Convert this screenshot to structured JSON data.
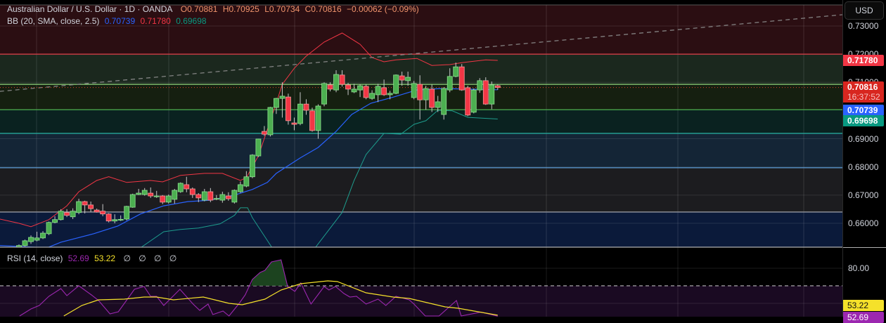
{
  "header": {
    "symbol": "Australian Dollar / U.S. Dollar · 1D · OANDA",
    "open": "O0.70881",
    "high": "H0.70925",
    "low": "L0.70734",
    "close": "C0.70816",
    "change": "−0.00062 (−0.09%)"
  },
  "bb_legend": {
    "label": "BB (20, SMA, close, 2.5)",
    "basis": "0.70739",
    "upper": "0.71780",
    "lower": "0.69698"
  },
  "rsi_legend": {
    "label": "RSI (14, close)",
    "rsi": "52.69",
    "ma": "53.22",
    "extras": [
      "∅",
      "∅",
      "∅",
      "∅"
    ]
  },
  "price_axis": {
    "currency": "USD",
    "ticks": [
      "0.73000",
      "0.72000",
      "0.71000",
      "0.69000",
      "0.68000",
      "0.67000",
      "0.66000"
    ],
    "tick_values": [
      0.73,
      0.72,
      0.71,
      0.69,
      0.68,
      0.67,
      0.66
    ],
    "last_price": "0.70816",
    "countdown": "16:37:52",
    "bb_upper": "0.71780",
    "bb_basis": "0.70739",
    "bb_lower": "0.69698"
  },
  "rsi_axis": {
    "ticks": [
      "80.00"
    ],
    "tick_values": [
      80
    ],
    "ma_label": "53.22",
    "rsi_label": "52.69"
  },
  "colors": {
    "up": "#4caf50",
    "down": "#f23645",
    "bb_basis": "#2962ff",
    "bb_upper": "#f23645",
    "bb_lower": "#089981",
    "rsi": "#9c27b0",
    "rsi_ma": "#f5e12a",
    "ohlc_text": "#f0946c"
  },
  "chart_data": {
    "type": "candlestick",
    "title": "Australian Dollar / U.S. Dollar · 1D · OANDA",
    "ylim": [
      0.6537,
      0.74
    ],
    "candles": [
      [
        0.6513,
        0.6525,
        0.6508,
        0.6521
      ],
      [
        0.6521,
        0.6542,
        0.6518,
        0.6538
      ],
      [
        0.6535,
        0.6557,
        0.6527,
        0.655
      ],
      [
        0.654,
        0.657,
        0.6536,
        0.6548
      ],
      [
        0.6548,
        0.6572,
        0.6544,
        0.6565
      ],
      [
        0.6563,
        0.6606,
        0.6558,
        0.6603
      ],
      [
        0.6603,
        0.6625,
        0.66,
        0.6613
      ],
      [
        0.6613,
        0.665,
        0.661,
        0.6643
      ],
      [
        0.6638,
        0.665,
        0.6622,
        0.6628
      ],
      [
        0.6623,
        0.6653,
        0.6615,
        0.6643
      ],
      [
        0.6638,
        0.6687,
        0.6632,
        0.6677
      ],
      [
        0.6677,
        0.668,
        0.6635,
        0.6665
      ],
      [
        0.6665,
        0.6677,
        0.664,
        0.6652
      ],
      [
        0.6647,
        0.6652,
        0.6638,
        0.664
      ],
      [
        0.6643,
        0.6668,
        0.6625,
        0.6633
      ],
      [
        0.6633,
        0.6636,
        0.6603,
        0.6608
      ],
      [
        0.6608,
        0.6632,
        0.66,
        0.6613
      ],
      [
        0.6613,
        0.6628,
        0.6608,
        0.6614
      ],
      [
        0.6615,
        0.6662,
        0.661,
        0.666
      ],
      [
        0.6657,
        0.6705,
        0.6655,
        0.6702
      ],
      [
        0.6702,
        0.6722,
        0.67,
        0.6707
      ],
      [
        0.6702,
        0.6725,
        0.6698,
        0.6717
      ],
      [
        0.6707,
        0.6727,
        0.669,
        0.6697
      ],
      [
        0.6697,
        0.6715,
        0.669,
        0.6697
      ],
      [
        0.6697,
        0.67,
        0.6668,
        0.6675
      ],
      [
        0.6675,
        0.6702,
        0.667,
        0.6697
      ],
      [
        0.6685,
        0.6722,
        0.667,
        0.6717
      ],
      [
        0.6712,
        0.6745,
        0.6708,
        0.6742
      ],
      [
        0.6737,
        0.6765,
        0.671,
        0.6722
      ],
      [
        0.6722,
        0.6727,
        0.669,
        0.6702
      ],
      [
        0.6702,
        0.6707,
        0.6675,
        0.669
      ],
      [
        0.6682,
        0.6722,
        0.6678,
        0.6712
      ],
      [
        0.6712,
        0.6725,
        0.6675,
        0.6682
      ],
      [
        0.6687,
        0.67,
        0.6682,
        0.6688
      ],
      [
        0.6682,
        0.6712,
        0.6673,
        0.6702
      ],
      [
        0.6697,
        0.671,
        0.668,
        0.6687
      ],
      [
        0.6675,
        0.672,
        0.667,
        0.6717
      ],
      [
        0.6712,
        0.6748,
        0.6708,
        0.6737
      ],
      [
        0.6732,
        0.6785,
        0.6728,
        0.6765
      ],
      [
        0.6765,
        0.6845,
        0.676,
        0.6842
      ],
      [
        0.6839,
        0.69,
        0.6835,
        0.6899
      ],
      [
        0.6926,
        0.6945,
        0.691,
        0.6916
      ],
      [
        0.6914,
        0.7013,
        0.6908,
        0.7011
      ],
      [
        0.7011,
        0.7045,
        0.6988,
        0.7043
      ],
      [
        0.7043,
        0.71,
        0.6975,
        0.7051
      ],
      [
        0.7048,
        0.706,
        0.695,
        0.6964
      ],
      [
        0.6956,
        0.6975,
        0.693,
        0.6951
      ],
      [
        0.6954,
        0.7065,
        0.6948,
        0.7023
      ],
      [
        0.7023,
        0.704,
        0.6985,
        0.7001
      ],
      [
        0.6999,
        0.701,
        0.6925,
        0.6929
      ],
      [
        0.6929,
        0.7022,
        0.69,
        0.7016
      ],
      [
        0.7023,
        0.71,
        0.7015,
        0.7096
      ],
      [
        0.7091,
        0.71,
        0.7068,
        0.7076
      ],
      [
        0.7073,
        0.7143,
        0.7065,
        0.7128
      ],
      [
        0.7126,
        0.7143,
        0.7085,
        0.7093
      ],
      [
        0.7091,
        0.7098,
        0.7055,
        0.7076
      ],
      [
        0.7066,
        0.7095,
        0.7062,
        0.7076
      ],
      [
        0.7073,
        0.7093,
        0.7048,
        0.7088
      ],
      [
        0.7086,
        0.7092,
        0.704,
        0.7046
      ],
      [
        0.7043,
        0.7072,
        0.7038,
        0.7061
      ],
      [
        0.7056,
        0.7095,
        0.703,
        0.7086
      ],
      [
        0.7081,
        0.711,
        0.7052,
        0.7056
      ],
      [
        0.7056,
        0.707,
        0.704,
        0.7061
      ],
      [
        0.7061,
        0.7128,
        0.7058,
        0.7126
      ],
      [
        0.7123,
        0.7138,
        0.7088,
        0.7108
      ],
      [
        0.7106,
        0.7138,
        0.7088,
        0.7118
      ],
      [
        0.7046,
        0.7105,
        0.704,
        0.7096
      ],
      [
        0.7093,
        0.7125,
        0.6968,
        0.7038
      ],
      [
        0.7038,
        0.7088,
        0.7003,
        0.7078
      ],
      [
        0.7076,
        0.7092,
        0.6995,
        0.7011
      ],
      [
        0.7011,
        0.7052,
        0.6995,
        0.7031
      ],
      [
        0.6986,
        0.7083,
        0.6968,
        0.7078
      ],
      [
        0.7073,
        0.715,
        0.7065,
        0.7121
      ],
      [
        0.7121,
        0.717,
        0.7118,
        0.7155
      ],
      [
        0.7155,
        0.7165,
        0.707,
        0.7073
      ],
      [
        0.7081,
        0.7088,
        0.698,
        0.6984
      ],
      [
        0.6994,
        0.7078,
        0.699,
        0.7073
      ],
      [
        0.7073,
        0.7115,
        0.7063,
        0.7106
      ],
      [
        0.7106,
        0.7118,
        0.702,
        0.7023
      ],
      [
        0.7023,
        0.7103,
        0.7005,
        0.7091
      ],
      [
        0.70881,
        0.70925,
        0.70734,
        0.70816
      ]
    ],
    "bb_upper": [
      [
        -3.2,
        0.6615
      ],
      [
        0,
        0.66
      ],
      [
        2,
        0.6588
      ],
      [
        5,
        0.6613
      ],
      [
        8,
        0.6662
      ],
      [
        10,
        0.6712
      ],
      [
        13,
        0.6752
      ],
      [
        15,
        0.6765
      ],
      [
        18,
        0.6745
      ],
      [
        22,
        0.6752
      ],
      [
        24,
        0.6747
      ],
      [
        27,
        0.677
      ],
      [
        31,
        0.6777
      ],
      [
        34,
        0.6777
      ],
      [
        37,
        0.6752
      ],
      [
        38,
        0.6762
      ],
      [
        40,
        0.6839
      ],
      [
        41,
        0.6901
      ],
      [
        43,
        0.7026
      ],
      [
        44,
        0.7093
      ],
      [
        46,
        0.715
      ],
      [
        48,
        0.7193
      ],
      [
        51,
        0.7243
      ],
      [
        54,
        0.7275
      ],
      [
        57,
        0.7235
      ],
      [
        59,
        0.7188
      ],
      [
        61,
        0.7173
      ],
      [
        63,
        0.718
      ],
      [
        66.5,
        0.7185
      ],
      [
        69,
        0.716
      ],
      [
        72,
        0.7163
      ],
      [
        74,
        0.717
      ],
      [
        78,
        0.718
      ],
      [
        80,
        0.7178
      ]
    ],
    "bb_basis": [
      [
        -3.2,
        0.6521
      ],
      [
        4.7,
        0.6513
      ],
      [
        7,
        0.6533
      ],
      [
        12.5,
        0.6563
      ],
      [
        16.5,
        0.659
      ],
      [
        20.3,
        0.6633
      ],
      [
        24.2,
        0.6662
      ],
      [
        28.2,
        0.6677
      ],
      [
        32,
        0.6682
      ],
      [
        36,
        0.67
      ],
      [
        39,
        0.672
      ],
      [
        41.5,
        0.6745
      ],
      [
        43,
        0.6777
      ],
      [
        47,
        0.6832
      ],
      [
        50,
        0.6869
      ],
      [
        53,
        0.6926
      ],
      [
        55.6,
        0.6986
      ],
      [
        58.8,
        0.7026
      ],
      [
        62.6,
        0.7048
      ],
      [
        66.5,
        0.7073
      ],
      [
        70.5,
        0.7078
      ],
      [
        80,
        0.70739
      ]
    ],
    "bb_lower": [
      [
        19,
        0.6496
      ],
      [
        20.3,
        0.6513
      ],
      [
        24.2,
        0.657
      ],
      [
        27,
        0.6578
      ],
      [
        30,
        0.6583
      ],
      [
        33.6,
        0.6598
      ],
      [
        36,
        0.6628
      ],
      [
        37,
        0.6655
      ],
      [
        38.2,
        0.6655
      ],
      [
        39,
        0.662
      ],
      [
        42.3,
        0.6513
      ],
      [
        46,
        0.6446
      ],
      [
        49.5,
        0.6513
      ],
      [
        54,
        0.6638
      ],
      [
        56,
        0.6752
      ],
      [
        58,
        0.6844
      ],
      [
        61,
        0.6919
      ],
      [
        63.8,
        0.6916
      ],
      [
        66,
        0.6951
      ],
      [
        68,
        0.6964
      ],
      [
        70,
        0.7001
      ],
      [
        72.4,
        0.6999
      ],
      [
        75,
        0.6976
      ],
      [
        80,
        0.69698
      ]
    ],
    "levels": [
      {
        "price": 0.72,
        "color": "#e0404a"
      },
      {
        "price": 0.7093,
        "color": "#8fd47a"
      },
      {
        "price": 0.7003,
        "color": "#4caf50"
      },
      {
        "price": 0.6919,
        "color": "#26a69a"
      },
      {
        "price": 0.6797,
        "color": "#5b9bd5"
      },
      {
        "price": 0.664,
        "color": "#9598a1"
      }
    ],
    "zones": [
      {
        "from": 0.74,
        "to": 0.72,
        "color": "#2b0e12"
      },
      {
        "from": 0.72,
        "to": 0.7093,
        "color": "#1b281e"
      },
      {
        "from": 0.7093,
        "to": 0.7003,
        "color": "#151f10"
      },
      {
        "from": 0.7003,
        "to": 0.6919,
        "color": "#0a2220"
      },
      {
        "from": 0.6919,
        "to": 0.6797,
        "color": "#142536"
      },
      {
        "from": 0.6797,
        "to": 0.664,
        "color": "#1c1c1f"
      },
      {
        "from": 0.664,
        "to": 0.65,
        "color": "#0b1a3a"
      }
    ],
    "trendline": [
      [
        -3.2,
        0.7068
      ],
      [
        137.6,
        0.734
      ]
    ],
    "rsi": {
      "overbought": 70,
      "ylim": [
        52,
        90
      ],
      "values": [
        [
          0.1,
          52.8
        ],
        [
          2,
          56.8
        ],
        [
          3.4,
          58.8
        ],
        [
          5,
          64
        ],
        [
          7,
          68.4
        ],
        [
          8,
          64.4
        ],
        [
          10,
          70
        ],
        [
          12.1,
          64.8
        ],
        [
          13.3,
          61.6
        ],
        [
          15.2,
          54
        ],
        [
          16.6,
          55.2
        ],
        [
          19.3,
          68
        ],
        [
          20.9,
          69.6
        ],
        [
          22,
          64
        ],
        [
          23,
          64
        ],
        [
          24.2,
          58.8
        ],
        [
          26.9,
          68
        ],
        [
          29.1,
          59.6
        ],
        [
          30.2,
          56
        ],
        [
          31.6,
          59.6
        ],
        [
          32.4,
          53.6
        ],
        [
          34.1,
          55.6
        ],
        [
          35.1,
          52.8
        ],
        [
          36.8,
          60
        ],
        [
          37.8,
          64.8
        ],
        [
          39,
          73.6
        ],
        [
          40.3,
          77.6
        ],
        [
          41.1,
          78.8
        ],
        [
          42.2,
          83.6
        ],
        [
          43.8,
          84.8
        ],
        [
          44.9,
          69.6
        ],
        [
          46.1,
          66.8
        ],
        [
          47.1,
          71.6
        ],
        [
          48.8,
          59.6
        ],
        [
          51,
          69.6
        ],
        [
          51.8,
          67.6
        ],
        [
          52.9,
          69.6
        ],
        [
          54.3,
          65.6
        ],
        [
          55.3,
          63.6
        ],
        [
          56.4,
          64
        ],
        [
          58,
          59.6
        ],
        [
          60,
          62.4
        ],
        [
          61.3,
          58.8
        ],
        [
          63,
          64
        ],
        [
          65.2,
          62
        ],
        [
          66,
          59.6
        ],
        [
          67.9,
          52.8
        ],
        [
          70.2,
          52.8
        ],
        [
          73.1,
          61.6
        ],
        [
          73.9,
          52.8
        ],
        [
          77.2,
          55
        ],
        [
          80,
          52.69
        ]
      ],
      "ma": [
        [
          7.5,
          52.8
        ],
        [
          10.5,
          58.8
        ],
        [
          13.3,
          62
        ],
        [
          17.6,
          62.4
        ],
        [
          20.9,
          63.6
        ],
        [
          23,
          63.6
        ],
        [
          25.8,
          62
        ],
        [
          30.8,
          63.6
        ],
        [
          35.1,
          60
        ],
        [
          37.3,
          59.2
        ],
        [
          41.1,
          62.4
        ],
        [
          43.8,
          67.6
        ],
        [
          47.1,
          71.2
        ],
        [
          51.6,
          72.8
        ],
        [
          53.2,
          72.4
        ],
        [
          58,
          66
        ],
        [
          62.5,
          63.6
        ],
        [
          65.2,
          62.8
        ],
        [
          71.2,
          58
        ],
        [
          73.4,
          57.2
        ],
        [
          80,
          53.22
        ]
      ]
    }
  }
}
